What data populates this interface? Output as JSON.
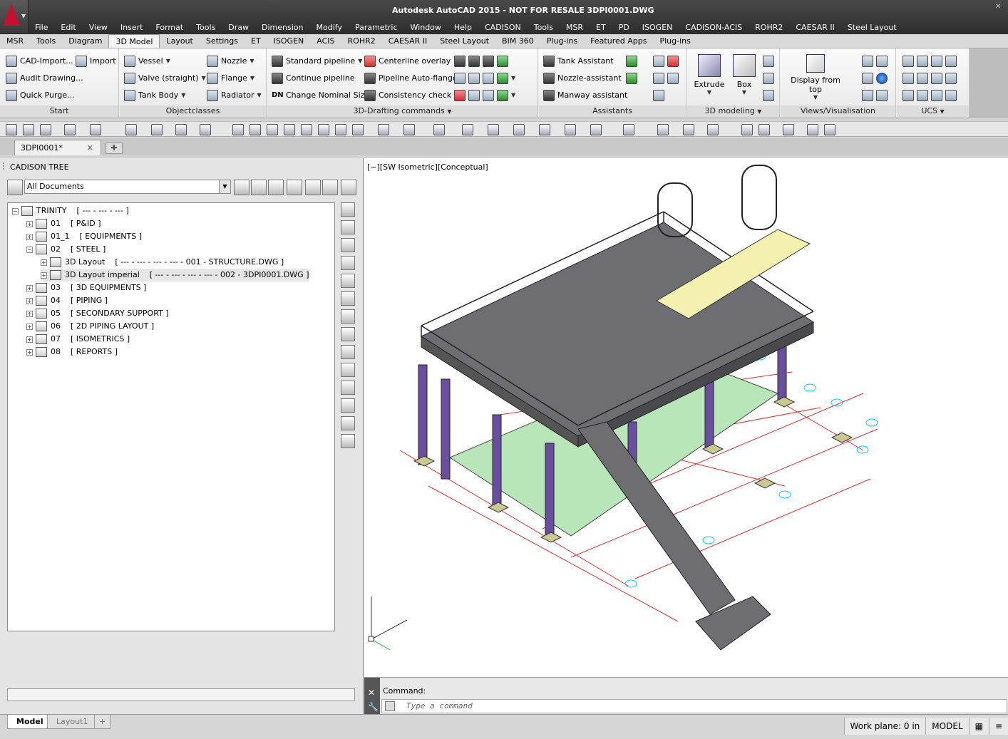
{
  "window": {
    "title": "Autodesk AutoCAD 2015 - NOT FOR RESALE    3DPI0001.DWG"
  },
  "menubar": [
    "File",
    "Edit",
    "View",
    "Insert",
    "Format",
    "Tools",
    "Draw",
    "Dimension",
    "Modify",
    "Parametric",
    "Window",
    "Help",
    "CADISON",
    "Tools",
    "MSR",
    "ET",
    "PD",
    "ISOGEN",
    "CADISON-ACIS",
    "ROHR2",
    "CAESAR II",
    "Steel Layout"
  ],
  "ribbon_tabs": [
    "MSR",
    "Tools",
    "Diagram",
    "3D Model",
    "Layout",
    "Settings",
    "ET",
    "ISOGEN",
    "ACIS",
    "ROHR2",
    "CAESAR II",
    "Steel Layout",
    "BIM 360",
    "Plug-ins",
    "Featured Apps",
    "Plug-ins"
  ],
  "ribbon_active_tab": "3D Model",
  "ribbon": {
    "start": {
      "label": "Start",
      "items": [
        "CAD-Import...",
        "Import",
        "Audit Drawing...",
        "Quick Purge..."
      ]
    },
    "objectclasses": {
      "label": "Objectclasses",
      "items": [
        "Vessel",
        "Nozzle",
        "Valve (straight)",
        "Flange",
        "Tank Body",
        "Radiator"
      ]
    },
    "drafting": {
      "label": "3D-Drafting commands",
      "items": [
        "Standard pipeline",
        "Centerline overlay",
        "Continue pipeline",
        "Pipeline Auto-flange",
        "Change Nominal Size",
        "Consistency check"
      ],
      "dn_label": "DN"
    },
    "assistants": {
      "label": "Assistants",
      "items": [
        "Tank Assistant",
        "Nozzle-assistant",
        "Manway assistant"
      ]
    },
    "modeling": {
      "label": "3D modeling",
      "items": [
        "Extrude",
        "Box"
      ]
    },
    "views": {
      "label": "Views/Visualisation",
      "items": [
        "Display from top"
      ]
    },
    "ucs": {
      "label": "UCS"
    }
  },
  "document_tab": {
    "label": "3DPI0001*",
    "close": "✕"
  },
  "left_panel": {
    "title": "CADISON TREE",
    "selector": "All Documents",
    "tree": [
      {
        "label": "TRINITY",
        "detail": "[ --- - --- - --- ]",
        "level": 0,
        "expanded": true
      },
      {
        "label": "01",
        "detail": "[ P&ID ]",
        "level": 1,
        "expanded": false
      },
      {
        "label": "01_1",
        "detail": "[ EQUIPMENTS ]",
        "level": 1,
        "expanded": false
      },
      {
        "label": "02",
        "detail": "[ STEEL ]",
        "level": 1,
        "expanded": true
      },
      {
        "label": "3D Layout",
        "detail": "[ --- - --- - --- - --- - 001 - STRUCTURE.DWG ]",
        "level": 2,
        "expanded": false
      },
      {
        "label": "3D Layout imperial",
        "detail": "[ --- - --- - --- - --- - 002 - 3DPI0001.DWG ]",
        "level": 2,
        "expanded": false,
        "selected": true
      },
      {
        "label": "03",
        "detail": "[ 3D EQUIPMENTS ]",
        "level": 1,
        "expanded": false
      },
      {
        "label": "04",
        "detail": "[ PIPING ]",
        "level": 1,
        "expanded": false
      },
      {
        "label": "05",
        "detail": "[ SECONDARY SUPPORT ]",
        "level": 1,
        "expanded": false
      },
      {
        "label": "06",
        "detail": "[ 2D PIPING LAYOUT ]",
        "level": 1,
        "expanded": false
      },
      {
        "label": "07",
        "detail": "[ ISOMETRICS ]",
        "level": 1,
        "expanded": false
      },
      {
        "label": "08",
        "detail": "[ REPORTS ]",
        "level": 1,
        "expanded": false
      }
    ]
  },
  "viewport": {
    "label": "[−][SW Isometric][Conceptual]"
  },
  "command": {
    "history": "Command:",
    "placeholder": "Type a command"
  },
  "layout_tabs": [
    "Model",
    "Layout1",
    "+"
  ],
  "status": {
    "workplane": "Work plane: 0 in",
    "mode": "MODEL"
  },
  "colors": {
    "title_bg": "#2d2d2d",
    "accent_red": "#c8102e",
    "steel": "#6e6e72",
    "column": "#6a4fa0",
    "grid_line": "#e03030",
    "glass": "#b8e6b8",
    "roof": "#f4f0b0"
  }
}
